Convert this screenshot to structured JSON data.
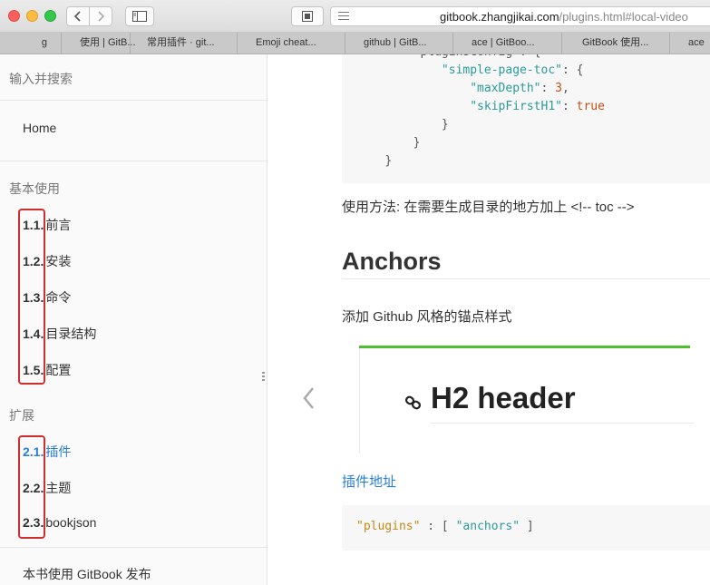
{
  "browser": {
    "url_domain": "gitbook.zhangjikai.com",
    "url_path": "/plugins.html#local-video",
    "tabs": [
      {
        "label": "g"
      },
      {
        "label": "使用 | GitB..."
      },
      {
        "label": "常用插件 · git..."
      },
      {
        "label": "Emoji cheat..."
      },
      {
        "label": "github | GitB..."
      },
      {
        "label": "ace | GitBoo..."
      },
      {
        "label": "GitBook 使用..."
      },
      {
        "label": "ace"
      }
    ]
  },
  "sidebar": {
    "search_placeholder": "输入并搜索",
    "home": "Home",
    "sections": [
      {
        "header": "基本使用"
      },
      {
        "header": "扩展"
      }
    ],
    "items": [
      {
        "num": "1.1.",
        "label": "前言"
      },
      {
        "num": "1.2.",
        "label": "安装"
      },
      {
        "num": "1.3.",
        "label": "命令"
      },
      {
        "num": "1.4.",
        "label": "目录结构"
      },
      {
        "num": "1.5.",
        "label": "配置"
      },
      {
        "num": "2.1.",
        "label": "插件"
      },
      {
        "num": "2.2.",
        "label": "主题"
      },
      {
        "num": "2.3.",
        "label": "bookjson"
      }
    ],
    "footer": "本书使用 GitBook 发布",
    "active_color": "#2a7fd5"
  },
  "content": {
    "code_top": {
      "key1": "\"simple-page-toc\"",
      "key2": "\"maxDepth\"",
      "val2": "3",
      "key3": "\"skipFirstH1\"",
      "val3": "true"
    },
    "usage_text": "使用方法: 在需要生成目录的地方加上 <!-- toc -->",
    "heading": "Anchors",
    "anchors_desc": "添加 Github 风格的锚点样式",
    "demo_heading": "H2 header",
    "plugin_link": "插件地址",
    "code_bottom": {
      "key": "\"plugins\"",
      "val": "\"anchors\""
    }
  }
}
